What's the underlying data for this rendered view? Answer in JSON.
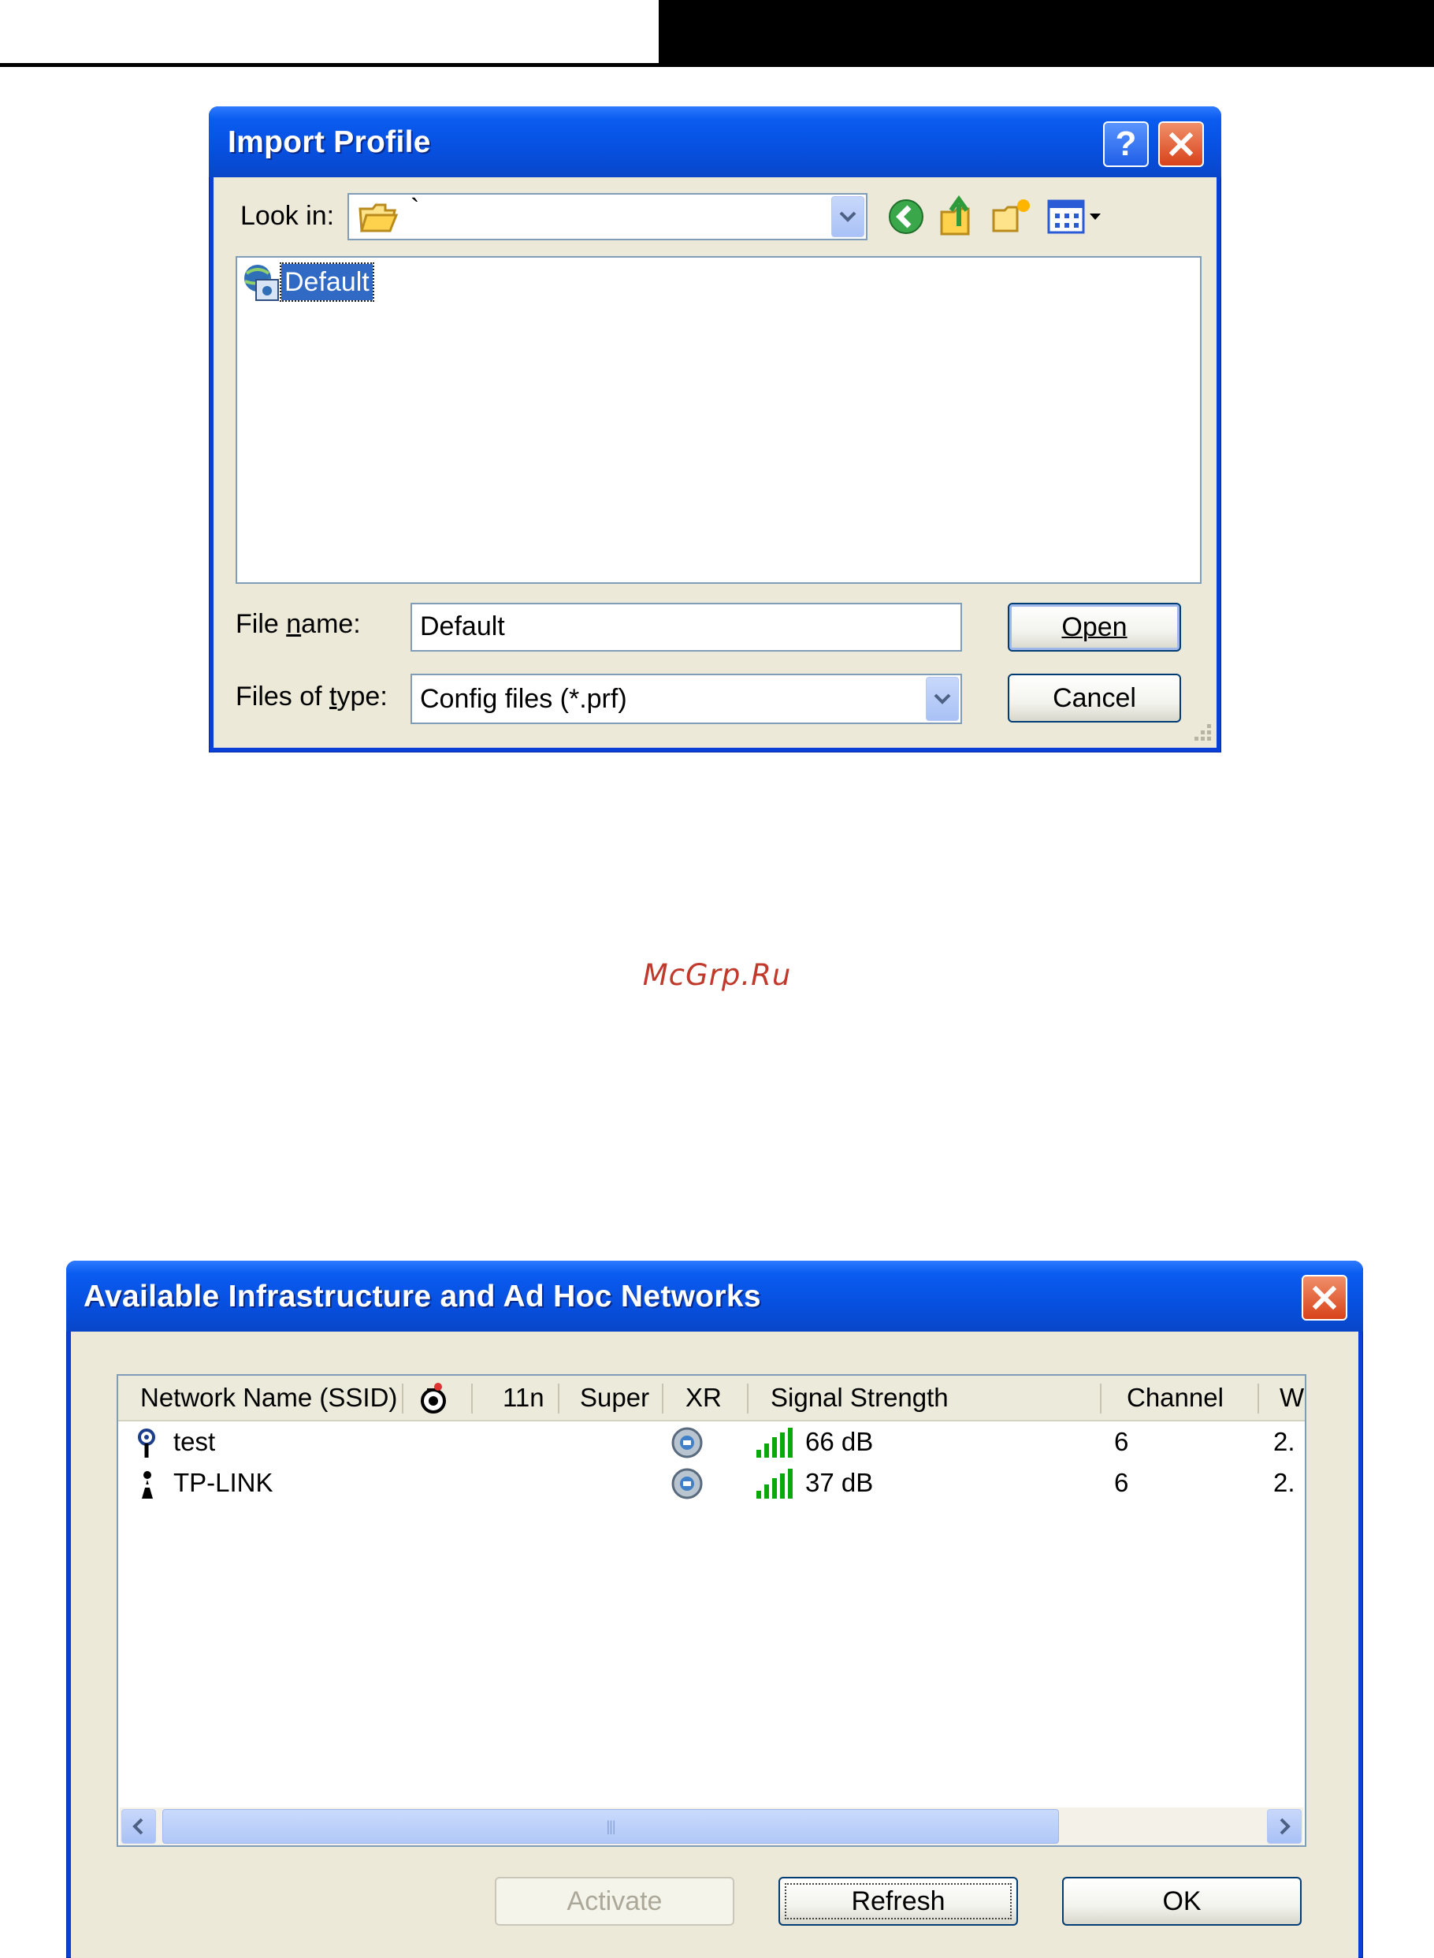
{
  "import_dialog": {
    "title": "Import Profile",
    "help_label": "?",
    "look_in_label": "Look in:",
    "look_in_value": "`",
    "file_item": "Default",
    "file_name_label": "File name:",
    "file_name_value": "Default",
    "files_of_type_label": "Files of type:",
    "files_of_type_value": "Config files (*.prf)",
    "open_label": "Open",
    "cancel_label": "Cancel"
  },
  "watermark": "McGrp.Ru",
  "networks_dialog": {
    "title": "Available Infrastructure and Ad Hoc Networks",
    "columns": [
      "Network Name (SSID)",
      "",
      "11n",
      "Super",
      "XR",
      "Signal Strength",
      "Channel",
      "W"
    ],
    "rows": [
      {
        "ssid": "test",
        "signal": "66 dB",
        "channel": "6",
        "w": "2.",
        "type_icon": "access-point-icon"
      },
      {
        "ssid": "TP-LINK",
        "signal": "37 dB",
        "channel": "6",
        "w": "2.",
        "type_icon": "adhoc-station-icon"
      }
    ],
    "scroll_grip": "|||",
    "activate_label": "Activate",
    "refresh_label": "Refresh",
    "ok_label": "OK"
  },
  "colors": {
    "titlebar": "#0750e0",
    "face": "#ece9d8",
    "border": "#7f9db9",
    "watermark": "#c0392b",
    "selection": "#316ac5"
  }
}
